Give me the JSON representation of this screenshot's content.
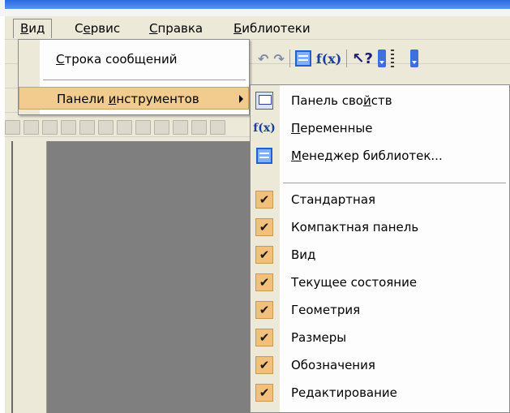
{
  "menubar": {
    "items": [
      {
        "label": "Вид",
        "underline": "В",
        "rest": "ид"
      },
      {
        "label": "Сервис",
        "pre": "С",
        "underline": "е",
        "rest": "рвис"
      },
      {
        "label": "Справка",
        "underline": "С",
        "rest": "правка"
      },
      {
        "label": "Библиотеки",
        "underline": "Б",
        "rest": "иблиотеки"
      }
    ]
  },
  "view_menu": {
    "items": [
      {
        "label": "Строка сообщений",
        "underline": "С",
        "rest": "трока сообщений"
      },
      {
        "label": "Панели инструментов",
        "pre": "Панели ",
        "underline": "и",
        "rest": "нструментов",
        "highlighted": true,
        "submenu": true
      }
    ]
  },
  "toolbars_submenu": {
    "items": [
      {
        "label": "Панель свойств",
        "pre": "Панель сво",
        "underline": "й",
        "rest": "ств",
        "icon": "properties-panel-icon"
      },
      {
        "label": "Переменные",
        "underline": "П",
        "rest": "еременные",
        "icon": "fx-icon"
      },
      {
        "label": "Менеджер библиотек...",
        "underline": "М",
        "rest": "енеджер библиотек...",
        "icon": "library-manager-icon"
      },
      {
        "label": "Стандартная",
        "checked": true
      },
      {
        "label": "Компактная панель",
        "checked": true
      },
      {
        "label": "Вид",
        "checked": true
      },
      {
        "label": "Текущее состояние",
        "checked": true
      },
      {
        "label": "Геометрия",
        "checked": true
      },
      {
        "label": "Размеры",
        "checked": true
      },
      {
        "label": "Обозначения",
        "checked": true
      },
      {
        "label": "Редактирование",
        "checked": true
      }
    ],
    "check_glyph": "✔"
  },
  "toolbar": {
    "fx_glyph": "f(x)",
    "help_glyph": "↖?"
  },
  "colors": {
    "menu_bg": "#ece9d8",
    "highlight": "#f2cc8f",
    "check_bg": "#f2c07a",
    "canvas": "#7f7f7f",
    "title_blue": "#2a6ae0"
  }
}
